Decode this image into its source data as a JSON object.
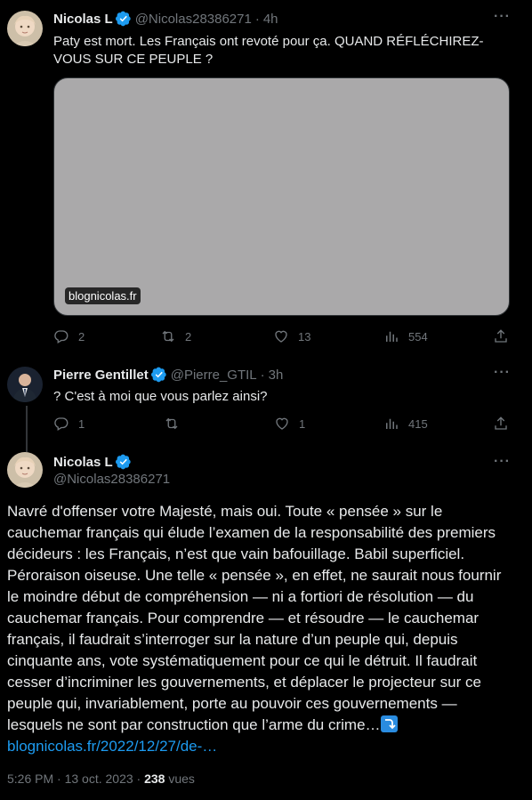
{
  "tweets": [
    {
      "name": "Nicolas L",
      "handle": "@Nicolas28386271",
      "time": "4h",
      "text_line1": "Paty est mort. Les Français ont revoté pour ça. QUAND RÉFLÉCHIREZ-",
      "text_line2": "VOUS SUR CE PEUPLE ?",
      "media_domain": "blognicolas.fr",
      "replies": "2",
      "reposts": "2",
      "likes": "13",
      "views": "554"
    },
    {
      "name": "Pierre Gentillet",
      "handle": "@Pierre_GTIL",
      "time": "3h",
      "text": "? C'est à moi que vous parlez ainsi?",
      "replies": "1",
      "reposts": "",
      "likes": "1",
      "views": "415"
    },
    {
      "name": "Nicolas L",
      "handle": "@Nicolas28386271",
      "lines": [
        "Navré d'offenser votre Majesté, mais oui. Toute « pensée » sur le",
        "cauchemar français qui élude l’examen de la responsabilité des premiers",
        "décideurs : les Français, n’est que vain bafouillage. Babil superficiel.",
        "Péroraison oiseuse. Une telle « pensée », en effet, ne saurait nous fournir",
        "le moindre début de compréhension — ni a fortiori de résolution — du",
        "cauchemar français. Pour comprendre — et résoudre — le cauchemar",
        "français, il faudrait s’interroger sur la nature d’un peuple qui, depuis",
        "cinquante ans, vote systématiquement pour ce qui le détruit. Il faudrait",
        "cesser d’incriminer les gouvernements, et déplacer le projecteur sur ce",
        "peuple qui, invariablement, porte au pouvoir ces gouvernements —",
        "lesquels ne sont par construction que l’arme du crime…"
      ],
      "link": "blognicolas.fr/2022/12/27/de-…",
      "date": "5:26 PM · 13 oct. 2023 · ",
      "view_count": "238",
      "views_label": " vues"
    }
  ],
  "dot": "·",
  "more": "···",
  "colors": {
    "accent": "#1d9bf0",
    "muted": "#71767b",
    "text": "#e7e9ea",
    "background": "#000000"
  },
  "icons": [
    "reply-icon",
    "repost-icon",
    "like-icon",
    "views-icon",
    "share-icon",
    "verified-badge-icon",
    "more-icon"
  ]
}
